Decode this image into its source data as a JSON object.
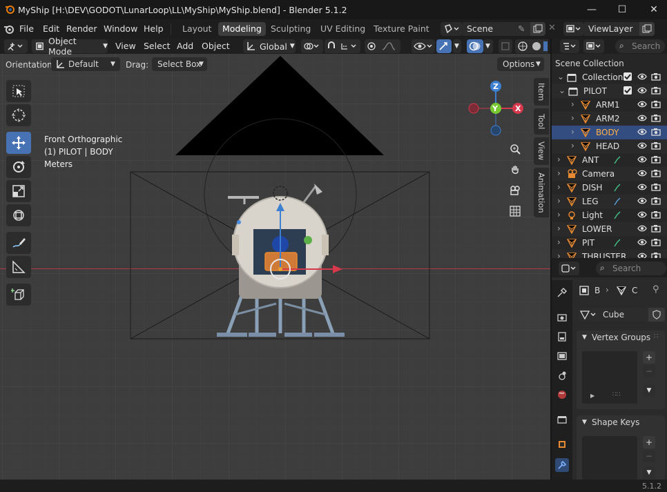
{
  "window": {
    "title": "MyShip [H:\\DEV\\GODOT\\LunarLoop\\LL\\MyShip\\MyShip.blend] - Blender 5.1.2",
    "minimize": "—",
    "maximize": "☐",
    "close": "✕"
  },
  "menu": {
    "file": "File",
    "edit": "Edit",
    "render": "Render",
    "window": "Window",
    "help": "Help"
  },
  "workspaces": [
    "Layout",
    "Modeling",
    "Sculpting",
    "UV Editing",
    "Texture Paint"
  ],
  "active_workspace": "Modeling",
  "scene": {
    "value": "Scene"
  },
  "view_layer": {
    "value": "ViewLayer"
  },
  "header": {
    "mode": "Object Mode",
    "view": "View",
    "select": "Select",
    "add": "Add",
    "object": "Object",
    "transform_orientation": "Global",
    "search_placeholder": "Search"
  },
  "tool_settings": {
    "orientation_label": "Orientation:",
    "orientation_value": "Default",
    "drag_label": "Drag:",
    "drag_value": "Select Box",
    "options": "Options"
  },
  "viewport": {
    "view_name": "Front Orthographic",
    "active_info": "(1) PILOT | BODY",
    "units": "Meters",
    "side_tabs": [
      "Item",
      "Tool",
      "View",
      "Animation"
    ],
    "gizmo": {
      "z": "Z",
      "y": "Y",
      "x": "X"
    }
  },
  "outliner": {
    "title": "Scene Collection",
    "rows": [
      {
        "label": "Collection",
        "indent": 0,
        "icon": "collection-icon",
        "selected": false
      },
      {
        "label": "PILOT",
        "indent": 1,
        "icon": "collection-icon",
        "selected": false
      },
      {
        "label": "ARM1",
        "indent": 2,
        "icon": "mesh-icon",
        "selected": false
      },
      {
        "label": "ARM2",
        "indent": 2,
        "icon": "mesh-icon",
        "selected": false
      },
      {
        "label": "BODY",
        "indent": 2,
        "icon": "mesh-icon",
        "selected": true
      },
      {
        "label": "HEAD",
        "indent": 2,
        "icon": "mesh-icon",
        "selected": false
      },
      {
        "label": "ANT",
        "indent": 0,
        "icon": "mesh-icon",
        "selected": false
      },
      {
        "label": "Camera",
        "indent": 0,
        "icon": "camera-icon",
        "selected": false
      },
      {
        "label": "DISH",
        "indent": 0,
        "icon": "mesh-icon",
        "selected": false
      },
      {
        "label": "LEG",
        "indent": 0,
        "icon": "mesh-icon",
        "selected": false
      },
      {
        "label": "Light",
        "indent": 0,
        "icon": "light-icon",
        "selected": false
      },
      {
        "label": "LOWER",
        "indent": 0,
        "icon": "mesh-icon",
        "selected": false
      },
      {
        "label": "PIT",
        "indent": 0,
        "icon": "mesh-icon",
        "selected": false
      },
      {
        "label": "THRUSTER",
        "indent": 0,
        "icon": "mesh-icon",
        "selected": false
      }
    ]
  },
  "properties": {
    "search_placeholder": "Search",
    "breadcrumb_a": "B",
    "breadcrumb_b": "C",
    "mesh_name": "Cube",
    "vertex_groups": "Vertex Groups",
    "shape_keys": "Shape Keys"
  },
  "status": {
    "version": "5.1.2"
  },
  "colors": {
    "accent": "#4772b3",
    "selected_row": "#334d80",
    "x_axis": "#d6384c",
    "y_axis": "#78c832",
    "z_axis": "#3d7fd1"
  }
}
